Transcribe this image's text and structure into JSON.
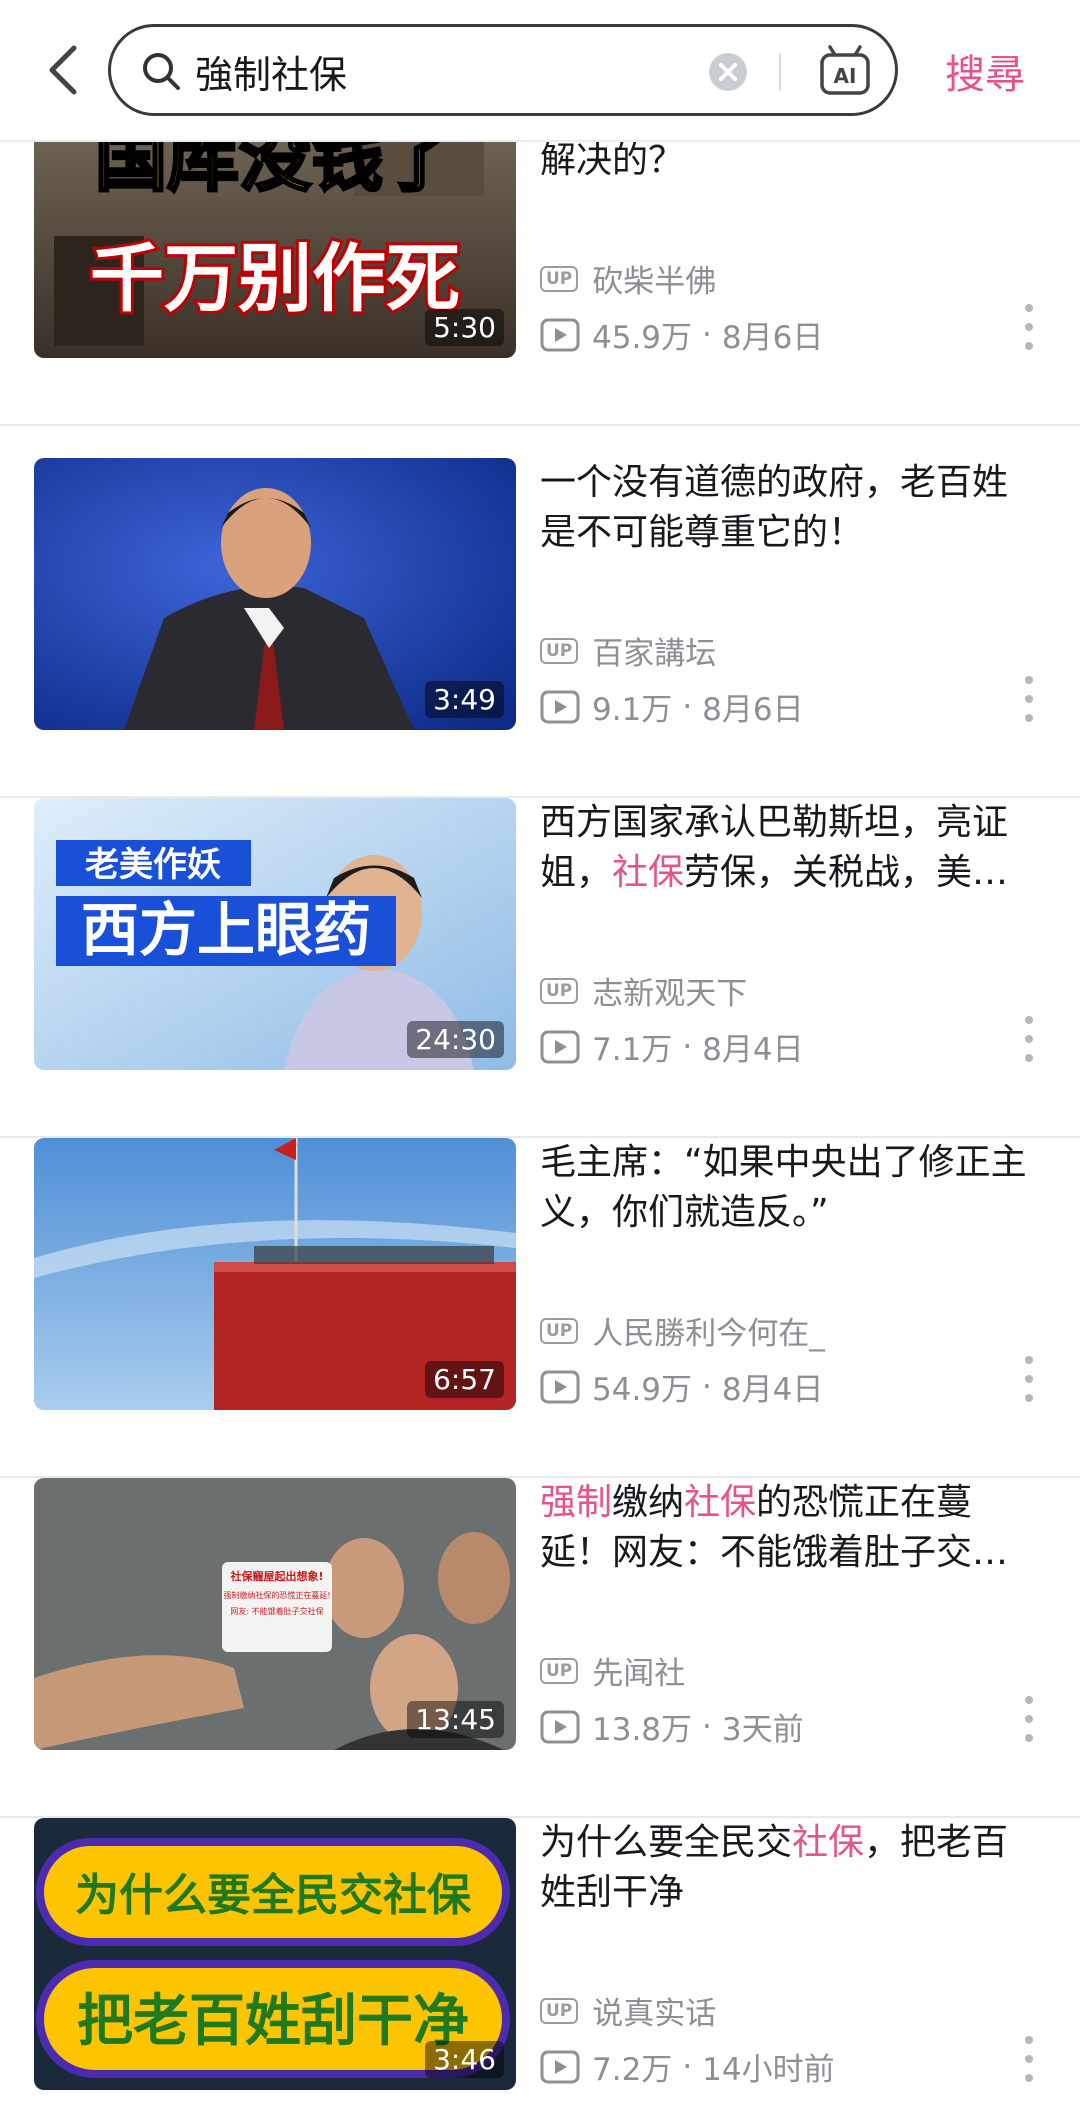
{
  "search": {
    "query": "強制社保",
    "action_label": "搜尋"
  },
  "results": [
    {
      "title_segments": [
        {
          "t": "国库没钱了，历朝历代是怎么解决的？",
          "h": false
        }
      ],
      "thumb_text": [
        "国库没钱了",
        "千万别作死"
      ],
      "duration": "5:30",
      "author": "砍柴半佛",
      "views": "45.9万",
      "date": "8月6日"
    },
    {
      "title_segments": [
        {
          "t": "一个没有道德的政府，老百姓是不可能尊重它的！",
          "h": false
        }
      ],
      "duration": "3:49",
      "author": "百家講坛",
      "views": "9.1万",
      "date": "8月6日"
    },
    {
      "title_segments": [
        {
          "t": "西方国家承认巴勒斯坦，亮证姐，",
          "h": false
        },
        {
          "t": "社保",
          "h": true
        },
        {
          "t": "劳保，关税战，美…",
          "h": false
        }
      ],
      "thumb_text": [
        "老美作妖",
        "西方上眼药"
      ],
      "duration": "24:30",
      "author": "志新观天下",
      "views": "7.1万",
      "date": "8月4日"
    },
    {
      "title_segments": [
        {
          "t": "毛主席：“如果中央出了修正主义，你们就造反。”",
          "h": false
        }
      ],
      "duration": "6:57",
      "author": "人民勝利今何在_",
      "views": "54.9万",
      "date": "8月4日"
    },
    {
      "title_segments": [
        {
          "t": "强制",
          "h": true
        },
        {
          "t": "缴纳",
          "h": false
        },
        {
          "t": "社保",
          "h": true
        },
        {
          "t": "的恐慌正在蔓延！网友：不能饿着肚子交…",
          "h": false
        }
      ],
      "thumb_text": [
        "社保寵屋起出想象!",
        "强制缴纳社保的恐慌正在蔓延!",
        "网友: 不能饿着肚子交社保"
      ],
      "duration": "13:45",
      "author": "先闻社",
      "views": "13.8万",
      "date": "3天前"
    },
    {
      "title_segments": [
        {
          "t": "为什么要全民交",
          "h": false
        },
        {
          "t": "社保",
          "h": true
        },
        {
          "t": "，把老百姓刮干净",
          "h": false
        }
      ],
      "thumb_text": [
        "为什么要全民交社保",
        "把老百姓刮干净"
      ],
      "duration": "3:46",
      "author": "说真实话",
      "views": "7.2万",
      "date": "14小时前"
    }
  ],
  "labels": {
    "up_badge": "UP",
    "ai_badge": "AI",
    "sep": "·"
  },
  "colors": {
    "accent": "#e8528a",
    "meta_gray": "#8d8f94"
  }
}
